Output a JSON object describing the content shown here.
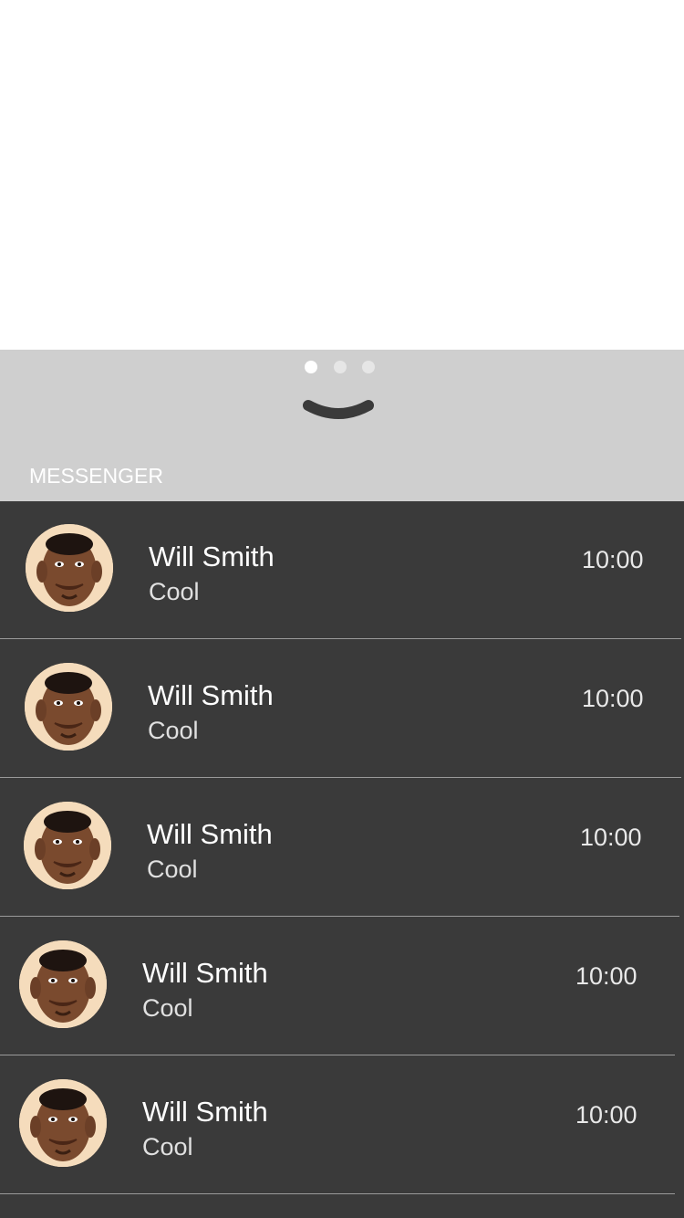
{
  "pager": {
    "page_count": 3,
    "active_index": 0
  },
  "section": {
    "label": "MESSENGER"
  },
  "conversations": [
    {
      "name": "Will Smith",
      "message": "Cool",
      "time": "10:00"
    },
    {
      "name": "Will Smith",
      "message": "Cool",
      "time": "10:00"
    },
    {
      "name": "Will Smith",
      "message": "Cool",
      "time": "10:00"
    },
    {
      "name": "Will Smith",
      "message": "Cool",
      "time": "10:00"
    },
    {
      "name": "Will Smith",
      "message": "Cool",
      "time": "10:00"
    }
  ],
  "colors": {
    "panel_bg": "#cfcfcf",
    "list_bg": "#3a3a3a",
    "divider": "#9a9a9a",
    "chevron": "#3a3a3a"
  },
  "icons": {
    "collapse": "chevron-down-icon"
  }
}
